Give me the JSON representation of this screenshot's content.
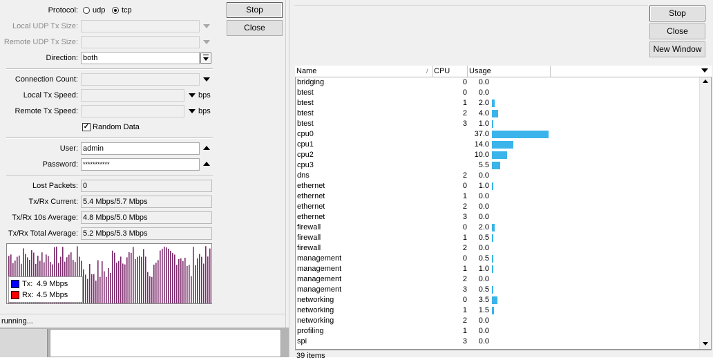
{
  "bandwidth_test": {
    "protocol_label": "Protocol:",
    "protocol_options": [
      "udp",
      "tcp"
    ],
    "protocol_selected": "tcp",
    "local_udp_tx_size_label": "Local UDP Tx Size:",
    "remote_udp_tx_size_label": "Remote UDP Tx Size:",
    "direction_label": "Direction:",
    "direction_value": "both",
    "connection_count_label": "Connection Count:",
    "local_tx_speed_label": "Local Tx Speed:",
    "remote_tx_speed_label": "Remote Tx Speed:",
    "speed_unit": "bps",
    "random_data_label": "Random Data",
    "random_data_checked": true,
    "user_label": "User:",
    "user_value": "admin",
    "password_label": "Password:",
    "password_value": "***********",
    "lost_packets_label": "Lost Packets:",
    "lost_packets_value": "0",
    "txrx_current_label": "Tx/Rx Current:",
    "txrx_current_value": "5.4 Mbps/5.7 Mbps",
    "txrx_10s_label": "Tx/Rx 10s Average:",
    "txrx_10s_value": "4.8 Mbps/5.0 Mbps",
    "txrx_total_label": "Tx/Rx Total Average:",
    "txrx_total_value": "5.2 Mbps/5.3 Mbps",
    "stop_button": "Stop",
    "close_button": "Close",
    "legend": {
      "tx_label": "Tx:",
      "tx_value": "4.9 Mbps",
      "rx_label": "Rx:",
      "rx_value": "4.5 Mbps"
    },
    "status_text": "running..."
  },
  "colors": {
    "tx": "#0000ff",
    "rx": "#ff0000",
    "graph_fill": "#7a2a6a",
    "usage_bar": "#3ab4ea"
  },
  "profile": {
    "stop_button": "Stop",
    "close_button": "Close",
    "new_window_button": "New Window",
    "columns": [
      "Name",
      "CPU",
      "Usage"
    ],
    "rows": [
      {
        "name": "bridging",
        "cpu": "0",
        "usage": "0.0",
        "usage_pct": 0.0
      },
      {
        "name": "btest",
        "cpu": "0",
        "usage": "0.0",
        "usage_pct": 0.0
      },
      {
        "name": "btest",
        "cpu": "1",
        "usage": "2.0",
        "usage_pct": 2.0
      },
      {
        "name": "btest",
        "cpu": "2",
        "usage": "4.0",
        "usage_pct": 4.0
      },
      {
        "name": "btest",
        "cpu": "3",
        "usage": "1.0",
        "usage_pct": 1.0
      },
      {
        "name": "cpu0",
        "cpu": "",
        "usage": "37.0",
        "usage_pct": 37.0
      },
      {
        "name": "cpu1",
        "cpu": "",
        "usage": "14.0",
        "usage_pct": 14.0
      },
      {
        "name": "cpu2",
        "cpu": "",
        "usage": "10.0",
        "usage_pct": 10.0
      },
      {
        "name": "cpu3",
        "cpu": "",
        "usage": "5.5",
        "usage_pct": 5.5
      },
      {
        "name": "dns",
        "cpu": "2",
        "usage": "0.0",
        "usage_pct": 0.0
      },
      {
        "name": "ethernet",
        "cpu": "0",
        "usage": "1.0",
        "usage_pct": 1.0
      },
      {
        "name": "ethernet",
        "cpu": "1",
        "usage": "0.0",
        "usage_pct": 0.0
      },
      {
        "name": "ethernet",
        "cpu": "2",
        "usage": "0.0",
        "usage_pct": 0.0
      },
      {
        "name": "ethernet",
        "cpu": "3",
        "usage": "0.0",
        "usage_pct": 0.0
      },
      {
        "name": "firewall",
        "cpu": "0",
        "usage": "2.0",
        "usage_pct": 2.0
      },
      {
        "name": "firewall",
        "cpu": "1",
        "usage": "0.5",
        "usage_pct": 0.5
      },
      {
        "name": "firewall",
        "cpu": "2",
        "usage": "0.0",
        "usage_pct": 0.0
      },
      {
        "name": "management",
        "cpu": "0",
        "usage": "0.5",
        "usage_pct": 0.5
      },
      {
        "name": "management",
        "cpu": "1",
        "usage": "1.0",
        "usage_pct": 1.0
      },
      {
        "name": "management",
        "cpu": "2",
        "usage": "0.0",
        "usage_pct": 0.0
      },
      {
        "name": "management",
        "cpu": "3",
        "usage": "0.5",
        "usage_pct": 0.5
      },
      {
        "name": "networking",
        "cpu": "0",
        "usage": "3.5",
        "usage_pct": 3.5
      },
      {
        "name": "networking",
        "cpu": "1",
        "usage": "1.5",
        "usage_pct": 1.5
      },
      {
        "name": "networking",
        "cpu": "2",
        "usage": "0.0",
        "usage_pct": 0.0
      },
      {
        "name": "profiling",
        "cpu": "1",
        "usage": "0.0",
        "usage_pct": 0.0
      },
      {
        "name": "spi",
        "cpu": "3",
        "usage": "0.0",
        "usage_pct": 0.0
      }
    ],
    "item_count": "39 items"
  }
}
